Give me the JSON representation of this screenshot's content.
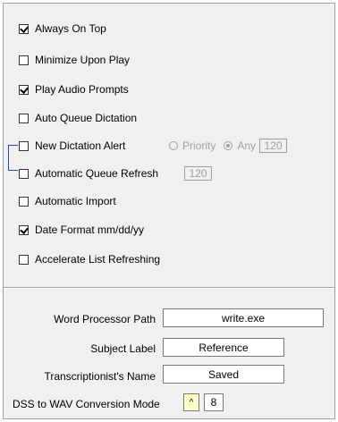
{
  "options": {
    "always_on_top": {
      "label": "Always On Top",
      "checked": true
    },
    "minimize_upon_play": {
      "label": "Minimize Upon Play",
      "checked": false
    },
    "play_audio_prompts": {
      "label": "Play Audio Prompts",
      "checked": true
    },
    "auto_queue_dictation": {
      "label": "Auto Queue Dictation",
      "checked": false
    },
    "new_dictation_alert": {
      "label": "New Dictation Alert",
      "checked": false
    },
    "automatic_queue_refresh": {
      "label": "Automatic Queue Refresh",
      "checked": false
    },
    "automatic_import": {
      "label": "Automatic Import",
      "checked": false
    },
    "date_format": {
      "label": "Date Format mm/dd/yy",
      "checked": true
    },
    "accelerate_list_refreshing": {
      "label": "Accelerate List Refreshing",
      "checked": false
    }
  },
  "alert": {
    "priority_label": "Priority",
    "any_label": "Any",
    "selected": "any",
    "interval_value": "120"
  },
  "queue_refresh": {
    "interval_value": "120"
  },
  "fields": {
    "word_processor_path": {
      "label": "Word Processor Path",
      "value": "write.exe"
    },
    "subject_label": {
      "label": "Subject Label",
      "value": "Reference"
    },
    "transcriptionist_name": {
      "label": "Transcriptionist's Name",
      "value": "Saved"
    },
    "dss_to_wav": {
      "label": "DSS to WAV Conversion Mode",
      "value": "8",
      "spin_glyph": "^"
    }
  }
}
